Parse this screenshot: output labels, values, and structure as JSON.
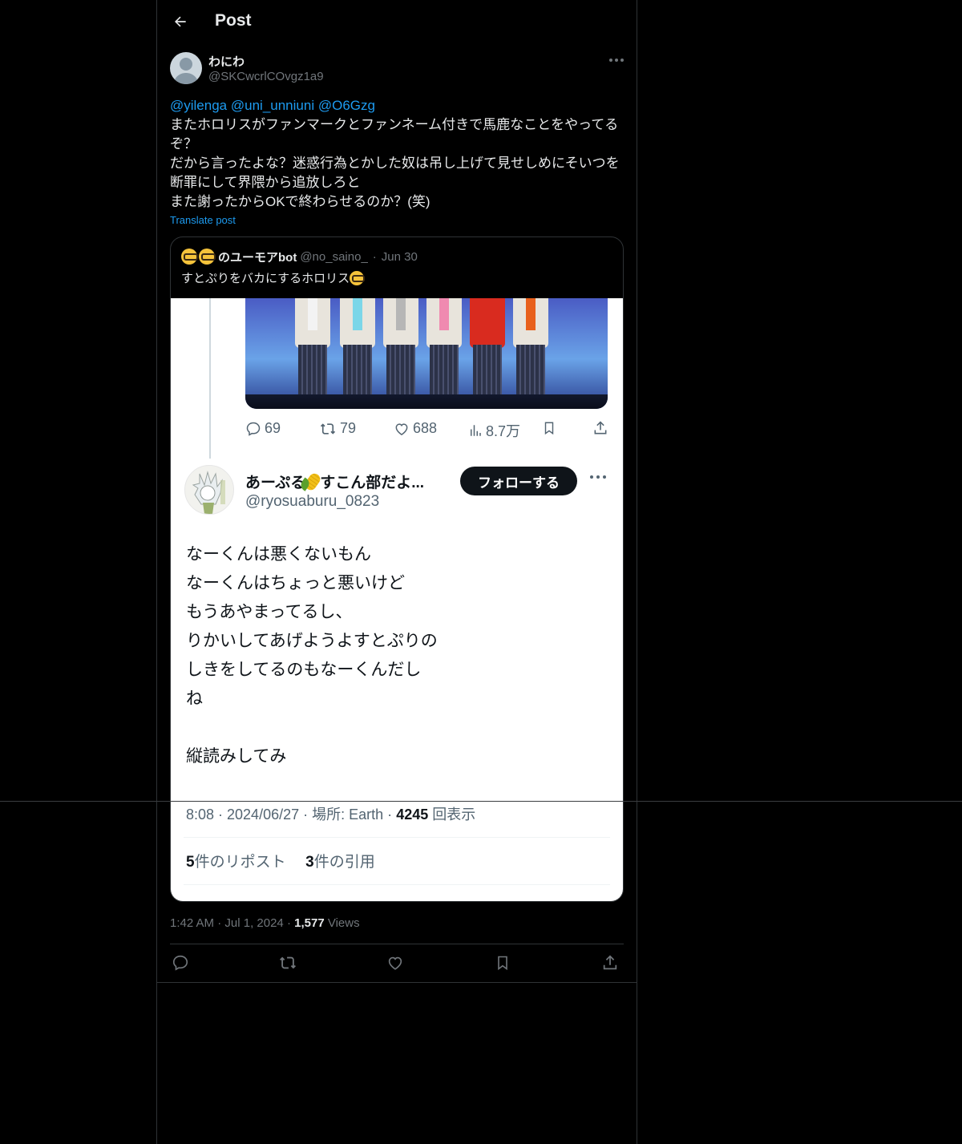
{
  "header": {
    "title": "Post",
    "back_icon": "arrow-left-icon"
  },
  "post": {
    "author_name": "わにわ",
    "author_handle": "@SKCwcrlCOvgz1a9",
    "mentions": [
      "@yilenga",
      "@uni_unniuni",
      "@O6Gzg"
    ],
    "text_lines": [
      "またホロリスがファンマークとファンネーム付きで馬鹿なことをやってる",
      "ぞ？",
      "だから言ったよな？迷惑行為とかした奴は吊し上げて見せしめにそいつを",
      "断罪にして界隈から追放しろと",
      "また謝ったからOKで終わらせるのか？(笑)"
    ],
    "translate_label": "Translate post",
    "time": "1:42 AM",
    "date": "Jul 1, 2024",
    "views_count": "1,577",
    "views_label": "Views"
  },
  "quote": {
    "name": "のユーモアbot",
    "handle": "@no_saino_",
    "date": "Jun 30",
    "text": "すとぷりをバカにするホロリス",
    "screenshot": {
      "actions": {
        "replies": "69",
        "reposts": "79",
        "likes": "688",
        "views": "8.7万"
      },
      "author_name_a": "あーぷる",
      "author_name_b": "すこん部だよ...",
      "author_handle": "@ryosuaburu_0823",
      "follow_label": "フォローする",
      "body_lines": [
        "なーくんは悪くないもん",
        "なーくんはちょっと悪いけど",
        "もうあやまってるし、",
        "りかいしてあげようよすとぷりの",
        "しきをしてるのもなーくんだし",
        "ね",
        "",
        "縦読みしてみ"
      ],
      "meta_time": "8:08 · 2024/06/27",
      "meta_place": "場所: Earth ·",
      "meta_views_count": "4245",
      "meta_views_label": "回表示",
      "reposts_count": "5",
      "reposts_label": "件のリポスト",
      "quotes_count": "3",
      "quotes_label": "件の引用"
    }
  },
  "colors": {
    "accent": "#1d9bf0",
    "bg": "#000000",
    "text": "#e7e9ea",
    "muted": "#71767b",
    "divider": "#2f3336"
  }
}
